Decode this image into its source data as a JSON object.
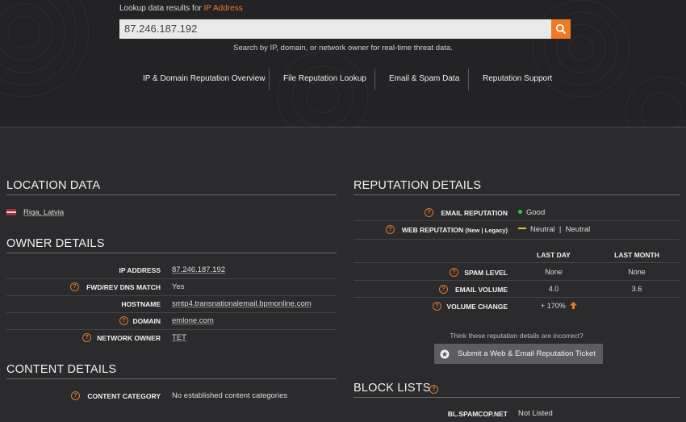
{
  "search": {
    "label_prefix": "Lookup data results for",
    "label_highlight": "IP Address",
    "value": "87.246.187.192",
    "help": "Search by IP, domain, or network owner for real-time threat data."
  },
  "nav": [
    "IP & Domain Reputation Overview",
    "File Reputation Lookup",
    "Email & Spam Data",
    "Reputation Support"
  ],
  "location": {
    "title": "LOCATION DATA",
    "place": "Riga, Latvia"
  },
  "owner": {
    "title": "OWNER DETAILS",
    "rows": [
      {
        "label": "IP ADDRESS",
        "value": "87.246.187.192"
      },
      {
        "label": "FWD/REV DNS MATCH",
        "value": "Yes"
      },
      {
        "label": "HOSTNAME",
        "value": "smtp4.transnationalemail.bpmonline.com"
      },
      {
        "label": "DOMAIN",
        "value": "emlone.com"
      },
      {
        "label": "NETWORK OWNER",
        "value": "TET"
      }
    ]
  },
  "content": {
    "title": "CONTENT DETAILS",
    "category_label": "CONTENT CATEGORY",
    "category_value": "No established content categories"
  },
  "reputation": {
    "title": "REPUTATION DETAILS",
    "email_label": "EMAIL REPUTATION",
    "email_value": "Good",
    "web_label": "WEB REPUTATION",
    "web_sub": "(New | Legacy)",
    "web_value": "Neutral  |  Neutral",
    "col_day": "LAST DAY",
    "col_month": "LAST MONTH",
    "spam_label": "SPAM LEVEL",
    "spam_day": "None",
    "spam_month": "None",
    "volume_label": "EMAIL VOLUME",
    "volume_day": "4.0",
    "volume_month": "3.6",
    "change_label": "VOLUME CHANGE",
    "change_value": "+ 170%",
    "incorrect_text": "Think these reputation details are incorrect?",
    "ticket_button": "Submit a Web & Email Reputation Ticket"
  },
  "block_lists": {
    "title": "BLOCK LISTS",
    "spamcop_label": "BL.SPAMCOP.NET",
    "spamcop_value": "Not Listed"
  },
  "colors": {
    "accent": "#f07a22",
    "good": "#2ecc40",
    "neutral": "#f0c020"
  }
}
